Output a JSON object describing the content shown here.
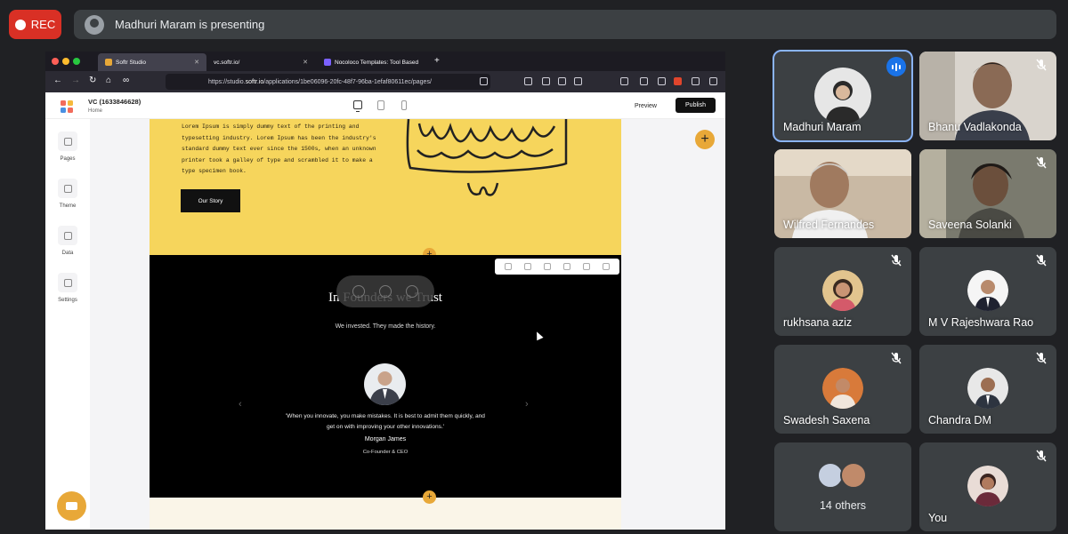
{
  "recording": {
    "label": "REC"
  },
  "presenter_banner": {
    "text": "Madhuri Maram is presenting"
  },
  "browser": {
    "tabs": [
      {
        "title": "Softr Studio"
      },
      {
        "title": "vc.softr.io/"
      },
      {
        "title": "Nocoloco Templates: Tool Based"
      }
    ],
    "url_prefix": "https://studio.",
    "url_domain": "softr.io",
    "url_rest": "/applications/1be06096-20fc-48f7-96ba-1efaf80611ec/pages/"
  },
  "app": {
    "title": "VC (1633846628)",
    "page": "Home",
    "preview_label": "Preview",
    "publish_label": "Publish",
    "sidebar": [
      {
        "label": "Pages",
        "icon": "pages-icon"
      },
      {
        "label": "Theme",
        "icon": "theme-icon"
      },
      {
        "label": "Data",
        "icon": "data-icon"
      },
      {
        "label": "Settings",
        "icon": "settings-icon"
      }
    ]
  },
  "hero": {
    "text": "Lorem Ipsum is simply dummy text of the printing and typesetting industry. Lorem Ipsum has been the industry's standard dummy text ever since the 1500s, when an unknown printer took a galley of type and scrambled it to make a type specimen book.",
    "button_label": "Our Story"
  },
  "testimonials": {
    "title": "In Founders we Trust",
    "subtitle": "We invested. They made the history.",
    "quote": "'When you innovate, you make mistakes. It is best to admit them quickly, and get on with improving your other innovations.'",
    "name": "Morgan James",
    "role": "Co-Founder & CEO"
  },
  "participants": [
    {
      "name": "Madhuri Maram",
      "mic": "speaking",
      "kind": "avatar"
    },
    {
      "name": "Bhanu Vadlakonda",
      "mic": "muted",
      "kind": "video"
    },
    {
      "name": "Wilfred Fernandes",
      "mic": "on",
      "kind": "video"
    },
    {
      "name": "Saveena Solanki",
      "mic": "muted",
      "kind": "video"
    },
    {
      "name": "rukhsana aziz",
      "mic": "muted",
      "kind": "avatar"
    },
    {
      "name": "M V Rajeshwara Rao",
      "mic": "muted",
      "kind": "avatar"
    },
    {
      "name": "Swadesh Saxena",
      "mic": "muted",
      "kind": "avatar"
    },
    {
      "name": "Chandra DM",
      "mic": "muted",
      "kind": "avatar"
    },
    {
      "name": "14 others",
      "mic": "none",
      "kind": "group"
    },
    {
      "name": "You",
      "mic": "muted",
      "kind": "avatar"
    }
  ],
  "colors": {
    "meet_bg": "#202124",
    "tile_bg": "#3c4043",
    "rec_red": "#d93025",
    "hero_yellow": "#f6d55c",
    "softr_orange": "#e8a838",
    "speaking_blue": "#1a73e8"
  }
}
